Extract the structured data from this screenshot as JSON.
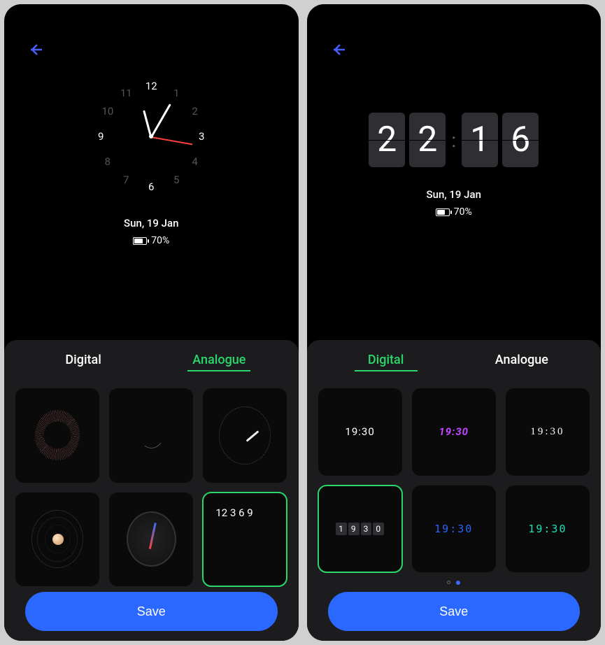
{
  "left": {
    "date": "Sun, 19 Jan",
    "battery": "70%",
    "tabs": {
      "digital": "Digital",
      "analogue": "Analogue",
      "active": "analogue"
    },
    "save": "Save",
    "analog_numbers": [
      "12",
      "1",
      "2",
      "3",
      "4",
      "5",
      "6",
      "7",
      "8",
      "9",
      "10",
      "11"
    ]
  },
  "right": {
    "time_digits": [
      "2",
      "2",
      "1",
      "6"
    ],
    "date": "Sun, 19 Jan",
    "battery": "70%",
    "tabs": {
      "digital": "Digital",
      "analogue": "Analogue",
      "active": "digital"
    },
    "save": "Save",
    "thumbs": {
      "plain": "19:30",
      "purple": "19:30",
      "serif": "19:30",
      "flip": [
        "1",
        "9",
        "3",
        "0"
      ],
      "dotblue": "19:30",
      "dotgreen": "19:30"
    }
  }
}
